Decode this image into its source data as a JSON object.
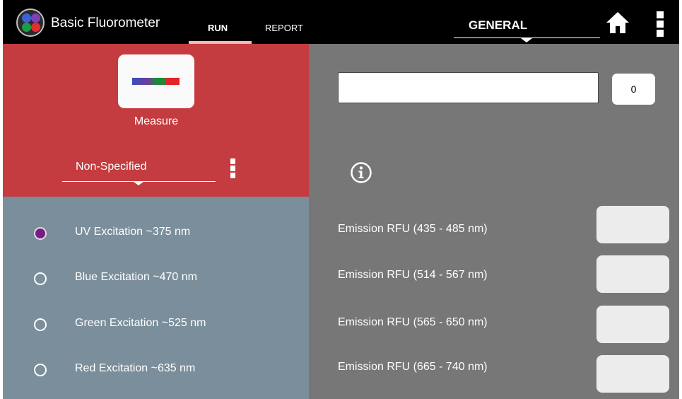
{
  "header": {
    "app_title": "Basic Fluorometer",
    "tabs": [
      {
        "label": "RUN",
        "active": true
      },
      {
        "label": "REPORT",
        "active": false
      }
    ],
    "mode_dropdown": {
      "selected": "GENERAL"
    },
    "logo_colors": [
      "#3b63d8",
      "#7e3fb8",
      "#1c9b45",
      "#e32e2e"
    ]
  },
  "measure": {
    "label": "Measure",
    "spectrum_colors": [
      "#3a4cba",
      "#6e3d9e",
      "#1d8a3a",
      "#e3232a"
    ]
  },
  "profile": {
    "selected": "Non-Specified"
  },
  "sample": {
    "name_value": "",
    "count": "0"
  },
  "excitation": {
    "options": [
      {
        "label": "UV Excitation ~375 nm",
        "selected": true
      },
      {
        "label": "Blue Excitation ~470 nm",
        "selected": false
      },
      {
        "label": "Green Excitation ~525 nm",
        "selected": false
      },
      {
        "label": "Red Excitation ~635 nm",
        "selected": false
      }
    ]
  },
  "emission": {
    "rows": [
      {
        "label": "Emission RFU (435 - 485 nm)",
        "value": ""
      },
      {
        "label": "Emission RFU (514 - 567 nm)",
        "value": ""
      },
      {
        "label": "Emission RFU (565 - 650 nm)",
        "value": ""
      },
      {
        "label": "Emission RFU (665 - 740 nm)",
        "value": ""
      }
    ]
  },
  "colors": {
    "red_panel": "#c43c3f",
    "gray_panel": "#777777",
    "blue_panel": "#7b8e9b",
    "selected_radio": "#7a1a88",
    "tab_underline": "#f7b7b5"
  },
  "icons": [
    "app-logo-icon",
    "home-icon",
    "more-vert-icon",
    "info-icon",
    "chevron-down-icon"
  ]
}
